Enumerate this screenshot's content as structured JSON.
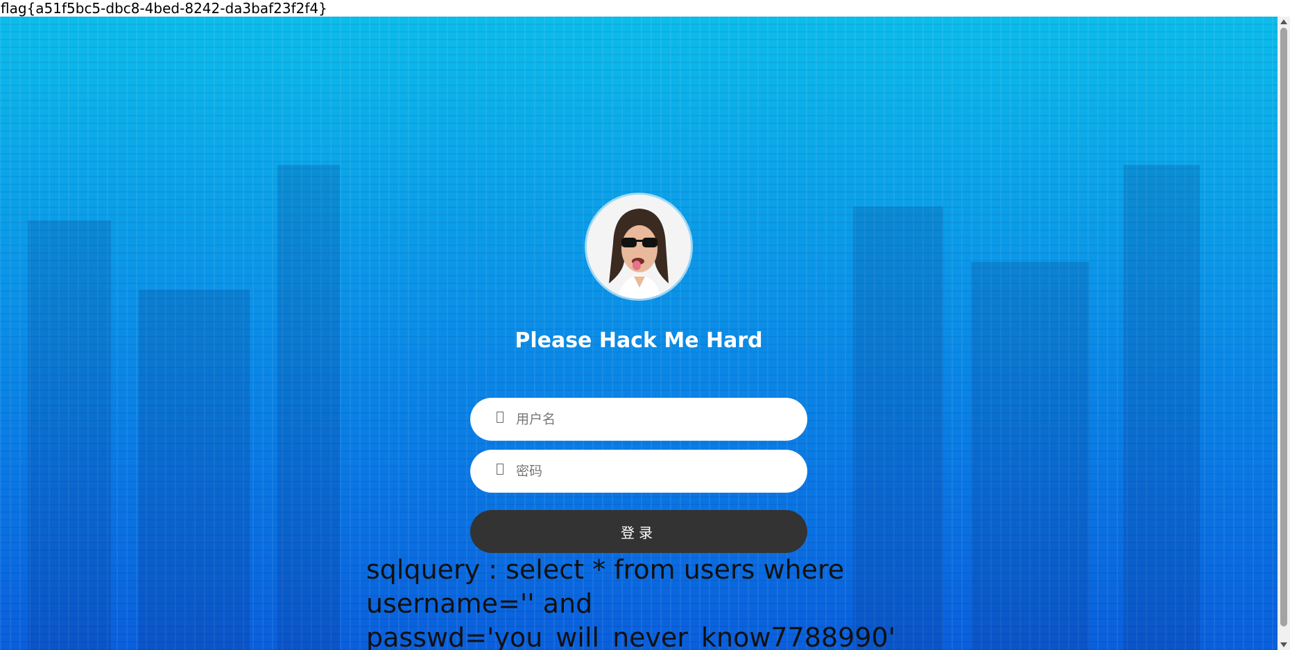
{
  "flag_text": "flag{a51f5bc5-dbc8-4bed-8242-da3baf23f2f4}",
  "login": {
    "title": "Please Hack Me Hard",
    "username_placeholder": "用户名",
    "password_placeholder": "密码",
    "username_icon": "user-icon",
    "password_icon": "lock-icon",
    "submit_label": "登录"
  },
  "sql_query": "sqlquery : select * from users where username='' and passwd='you_will_never_know7788990'",
  "colors": {
    "background_top": "#0cbcea",
    "background_bottom": "#0a5fdc",
    "button": "#333333",
    "title": "#ffffff"
  }
}
